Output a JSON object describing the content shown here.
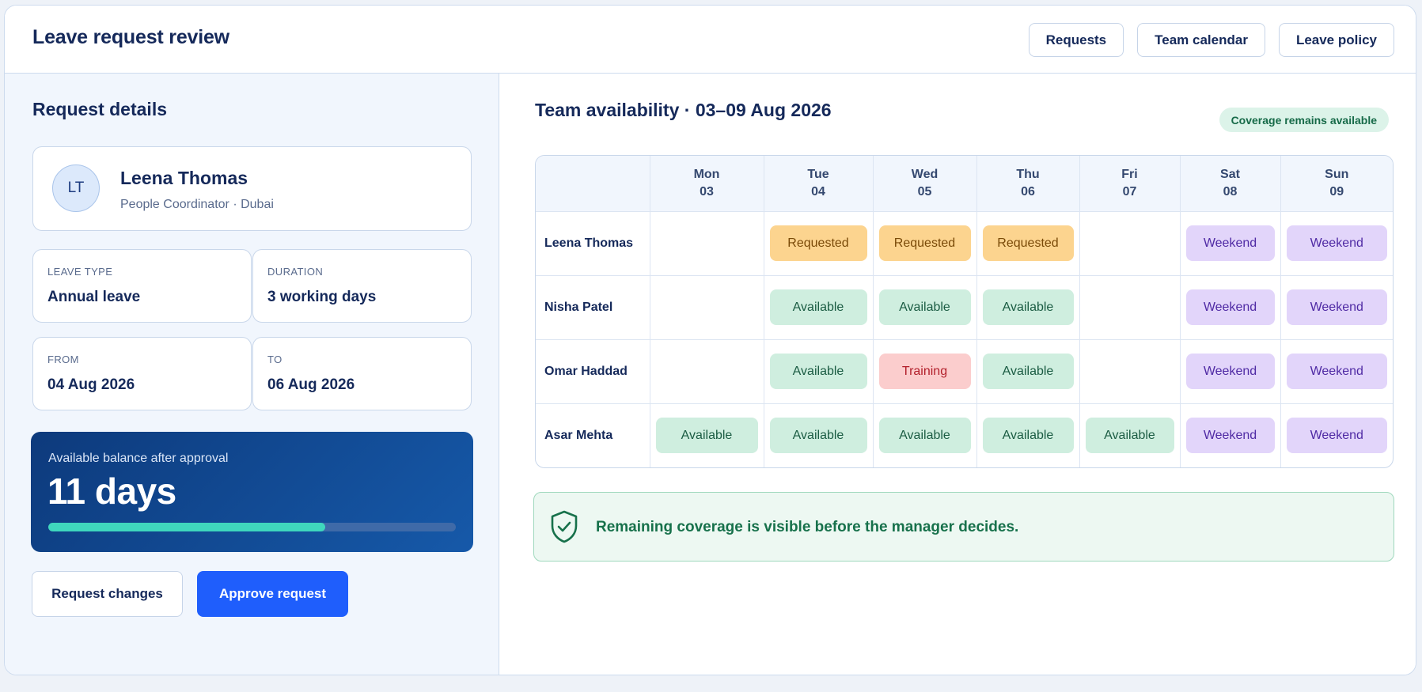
{
  "header": {
    "title": "Leave request review",
    "nav": [
      "Requests",
      "Team calendar",
      "Leave policy"
    ]
  },
  "request": {
    "section_title": "Request details",
    "person": {
      "initials": "LT",
      "name": "Leena Thomas",
      "role": "People Coordinator · Dubai"
    },
    "leave_type": {
      "label": "LEAVE TYPE",
      "value": "Annual leave"
    },
    "duration": {
      "label": "DURATION",
      "value": "3 working days"
    },
    "from": {
      "label": "FROM",
      "value": "04 Aug 2026"
    },
    "to": {
      "label": "TO",
      "value": "06 Aug 2026"
    },
    "balance": {
      "label": "Available balance after approval",
      "value": "11 days",
      "progress_fraction": 0.68
    },
    "actions": {
      "request_changes": "Request changes",
      "approve": "Approve request"
    }
  },
  "availability": {
    "title": "Team availability · 03–09 Aug 2026",
    "badge": "Coverage remains available",
    "days": [
      {
        "dow": "Mon",
        "date": "03"
      },
      {
        "dow": "Tue",
        "date": "04"
      },
      {
        "dow": "Wed",
        "date": "05"
      },
      {
        "dow": "Thu",
        "date": "06"
      },
      {
        "dow": "Fri",
        "date": "07"
      },
      {
        "dow": "Sat",
        "date": "08"
      },
      {
        "dow": "Sun",
        "date": "09"
      }
    ],
    "rows": [
      {
        "name": "Leena Thomas",
        "cells": [
          "",
          "Requested",
          "Requested",
          "Requested",
          "",
          "Weekend",
          "Weekend"
        ]
      },
      {
        "name": "Nisha Patel",
        "cells": [
          "",
          "Available",
          "Available",
          "Available",
          "",
          "Weekend",
          "Weekend"
        ]
      },
      {
        "name": "Omar Haddad",
        "cells": [
          "",
          "Available",
          "Training",
          "Available",
          "",
          "Weekend",
          "Weekend"
        ]
      },
      {
        "name": "Asar Mehta",
        "cells": [
          "Available",
          "Available",
          "Available",
          "Available",
          "Available",
          "Weekend",
          "Weekend"
        ]
      }
    ],
    "status_colors": {
      "Requested": "#fcd48f",
      "Available": "#cfeedf",
      "Training": "#fbcdcd",
      "Weekend": "#e2d5fa"
    },
    "notice": {
      "icon": "shield-check-icon",
      "text": "Remaining coverage is visible before the manager decides."
    }
  },
  "colors": {
    "accent": "#1f5efc",
    "balance_card": "#0d3a7c",
    "progress": "#3fd7bd"
  }
}
